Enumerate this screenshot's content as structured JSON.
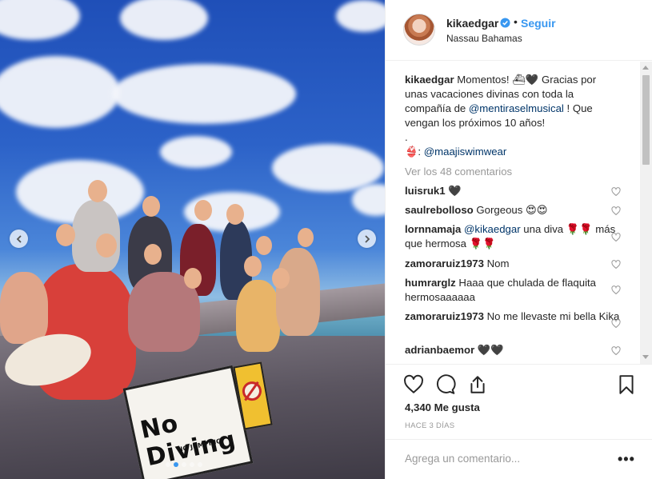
{
  "post": {
    "username": "kikaedgar",
    "separator": "•",
    "follow_label": "Seguir",
    "location": "Nassau Bahamas"
  },
  "photo": {
    "sign_text": "No Diving",
    "sign_subtext": "NO JUMPING",
    "carousel_count": 5,
    "carousel_active": 1
  },
  "caption": {
    "username": "kikaedgar",
    "text_1": "Momentos! ⛴🖤 Gracias por unas vacaciones divinas con toda la compañía de",
    "mention_1": "@mentiraselmusical",
    "text_2": "! Que vengan los próximos 10 años!",
    "dot": ".",
    "text_3": "👙:",
    "mention_2": "@maajiswimwear"
  },
  "view_all_comments": "Ver los 48 comentarios",
  "comments": [
    {
      "user": "luisruk1",
      "text": "🖤"
    },
    {
      "user": "saulrebolloso",
      "text": "Gorgeous 😍😍"
    },
    {
      "user": "lornnamaja",
      "text_mention": "@kikaedgar",
      "text": "una diva 🌹🌹 más que hermosa 🌹🌹"
    },
    {
      "user": "zamoraruiz1973",
      "text": "Nom"
    },
    {
      "user": "humrarglz",
      "text": "Haaa que chulada de flaquita hermosaaaaaa"
    },
    {
      "user": "zamoraruiz1973",
      "text": "No me llevaste mi bella Kika"
    },
    {
      "user": "adrianbaemor",
      "text": "🖤🖤"
    }
  ],
  "likes": "4,340 Me gusta",
  "time_ago": "HACE 3 DÍAS",
  "add_comment_placeholder": "Agrega un comentario...",
  "more_options": "•••",
  "colors": {
    "link": "#003569",
    "follow": "#3897f0",
    "muted": "#999999",
    "text": "#262626"
  }
}
